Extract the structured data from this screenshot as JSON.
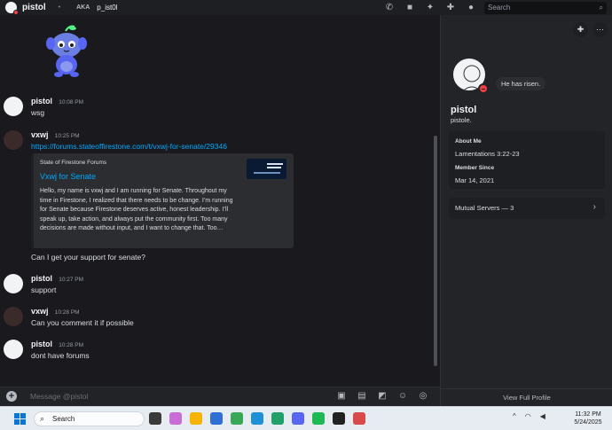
{
  "topbar": {
    "username": "pistol",
    "aka_label": "AKA",
    "alias": "p_ist0l",
    "search_placeholder": "Search"
  },
  "messages": [
    {
      "author": "pistol",
      "time": "10:08 PM",
      "text": "wsg"
    },
    {
      "author": "vxwj",
      "time": "10:25 PM",
      "link": "https://forums.stateoffirestone.com/t/vxwj-for-senate/29346"
    },
    {
      "text": "Can I get your support for senate?"
    },
    {
      "author": "pistol",
      "time": "10:27 PM",
      "text": "support"
    },
    {
      "author": "vxwj",
      "time": "10:28 PM",
      "text": "Can you comment it if possible"
    },
    {
      "author": "pistol",
      "time": "10:28 PM",
      "text": "dont have forums"
    }
  ],
  "embed": {
    "provider": "State of Firestone Forums",
    "title": "Vxwj for Senate",
    "description": "Hello, my name is vxwj and I am running for Senate. Throughout my time in Firestone, I realized that there needs to be change. I’m running for Senate because Firestone deserves active, honest leadership. I’ll speak up, take action, and always put the community first. Too many decisions are made without input, and I want to change that. Too…"
  },
  "composer": {
    "placeholder": "Message @pistol"
  },
  "profile": {
    "status": "He has risen.",
    "display_name": "pistol",
    "handle": "pistole.",
    "about_me_label": "About Me",
    "about_me": "Lamentations 3:22-23",
    "member_since_label": "Member Since",
    "member_since": "Mar 14, 2021",
    "mutual_servers": "Mutual Servers — 3",
    "view_full_profile": "View Full Profile"
  },
  "taskbar": {
    "search_label": "Search",
    "time": "11:32 PM",
    "date": "5/24/2025"
  },
  "colors": {
    "dnd": "#f23f43",
    "link": "#00a8fc",
    "chat_bg": "#1a1a1e",
    "panel_bg": "#232428"
  }
}
